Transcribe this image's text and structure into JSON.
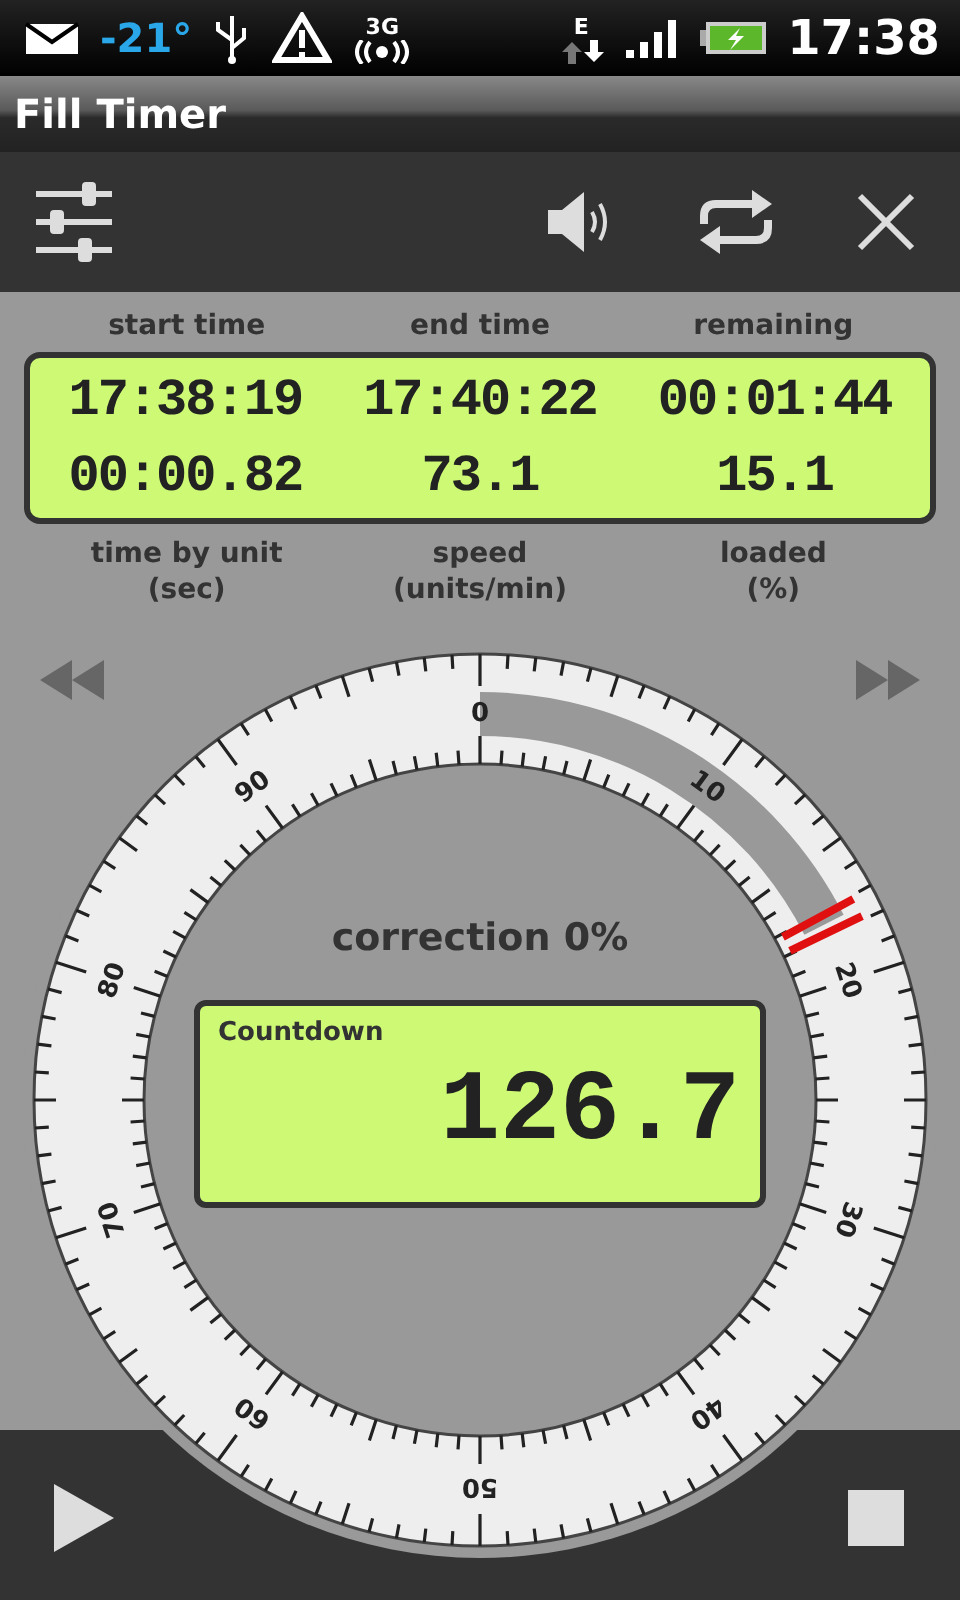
{
  "status_bar": {
    "temperature": "-21°",
    "network_type": "3G",
    "data_type": "E",
    "time": "17:38"
  },
  "title": "Fill Timer",
  "top_labels": [
    "start time",
    "end time",
    "remaining"
  ],
  "lcd_rows": [
    [
      "17:38:19",
      "17:40:22",
      "00:01:44"
    ],
    [
      "00:00.82",
      "73.1",
      "15.1"
    ]
  ],
  "bottom_labels": [
    "time by unit\n(sec)",
    "speed\n(units/min)",
    "loaded\n(%)"
  ],
  "dial": {
    "scale_labels": [
      "0",
      "10",
      "20",
      "30",
      "40",
      "50",
      "60",
      "70",
      "80",
      "90"
    ]
  },
  "correction": "correction 0%",
  "countdown": {
    "label": "Countdown",
    "value": "126.7"
  }
}
